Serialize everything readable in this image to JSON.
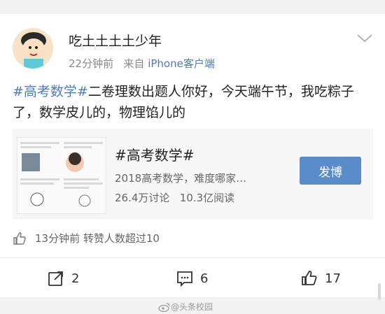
{
  "post": {
    "username": "吃土土土土少年",
    "time": "22分钟前",
    "source_prefix": "来自",
    "source": "iPhone客户端",
    "hashtag": "#高考数学#",
    "text": "二卷理数出题人你好，今天端午节，我吃粽子了，数学皮儿的，物理馅儿的"
  },
  "share_card": {
    "title": "#高考数学#",
    "description": "2018高考数学，难度哪家…",
    "discussions": "26.4万讨论",
    "reads": "10.3亿阅读",
    "button_label": "发博"
  },
  "likes_info": {
    "time": "13分钟前",
    "text": "转赞人数超过10"
  },
  "actions": {
    "repost_count": "2",
    "comment_count": "6",
    "like_count": "17"
  },
  "watermark": "@头条校园",
  "icons": [
    "avatar",
    "chevron-down-icon",
    "thumbs-up-icon",
    "repost-icon",
    "comment-icon",
    "like-icon"
  ]
}
